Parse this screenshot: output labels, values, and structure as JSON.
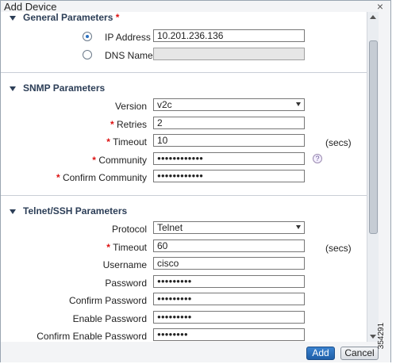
{
  "dialog": {
    "title": "Add Device",
    "close_glyph": "×"
  },
  "general": {
    "title": "General Parameters",
    "required_mark": "*",
    "ip_label": "IP Address",
    "ip_value": "10.201.236.136",
    "dns_label": "DNS Name",
    "dns_value": "",
    "selected": "ip"
  },
  "snmp": {
    "title": "SNMP Parameters",
    "version_label": "Version",
    "version_value": "v2c",
    "retries_label": "Retries",
    "retries_value": "2",
    "timeout_label": "Timeout",
    "timeout_value": "10",
    "timeout_unit": "(secs)",
    "community_label": "Community",
    "community_value": "●●●●●●●●●●●●",
    "confirm_community_label": "Confirm Community",
    "confirm_community_value": "●●●●●●●●●●●●",
    "help_glyph": "?"
  },
  "telnet": {
    "title": "Telnet/SSH Parameters",
    "protocol_label": "Protocol",
    "protocol_value": "Telnet",
    "timeout_label": "Timeout",
    "timeout_value": "60",
    "timeout_unit": "(secs)",
    "username_label": "Username",
    "username_value": "cisco",
    "password_label": "Password",
    "password_value": "●●●●●●●●●",
    "confirm_password_label": "Confirm Password",
    "confirm_password_value": "●●●●●●●●●",
    "enable_password_label": "Enable Password",
    "enable_password_value": "●●●●●●●●●",
    "confirm_enable_password_label": "Confirm Enable Password",
    "confirm_enable_password_value": "●●●●●●●●"
  },
  "required_mark": "*",
  "buttons": {
    "add": "Add",
    "cancel": "Cancel"
  },
  "figure_id": "354291",
  "colors": {
    "section_title": "#2c3e57",
    "required": "#dd1111",
    "primary_button": "#2a6fc0"
  }
}
